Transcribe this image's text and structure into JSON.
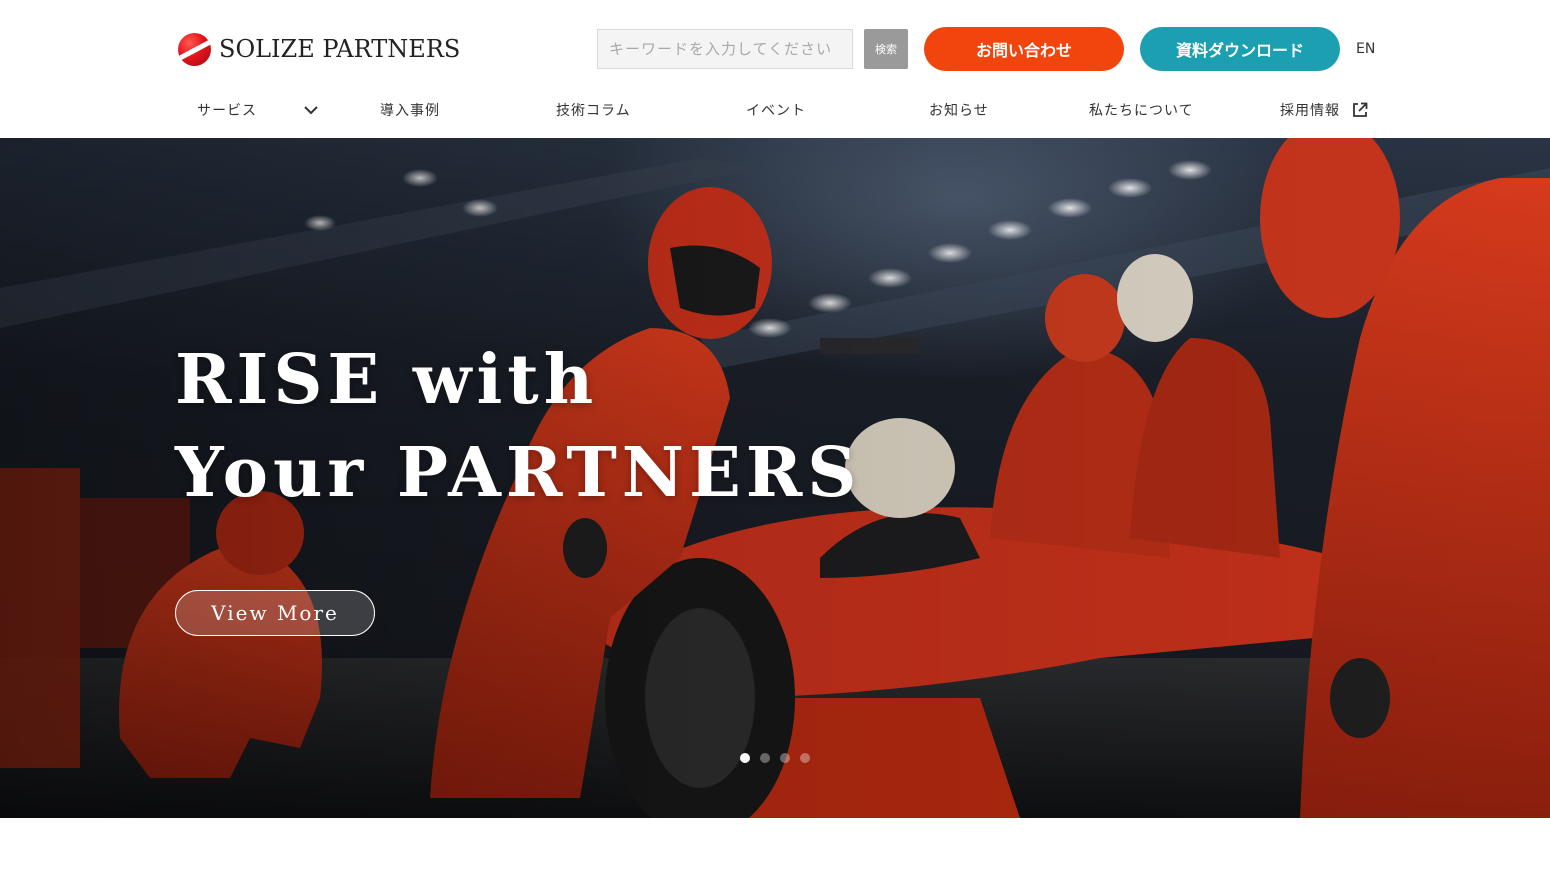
{
  "header": {
    "logo_text": "SOLIZE PARTNERS",
    "search": {
      "placeholder": "キーワードを入力してください",
      "button_label": "検索"
    },
    "contact_label": "お問い合わせ",
    "download_label": "資料ダウンロード",
    "lang_label": "EN"
  },
  "nav": {
    "items": [
      {
        "label": "サービス",
        "icon": "chevron-down-icon"
      },
      {
        "label": "導入事例"
      },
      {
        "label": "技術コラム"
      },
      {
        "label": "イベント"
      },
      {
        "label": "お知らせ"
      },
      {
        "label": "私たちについて"
      },
      {
        "label": "採用情報",
        "icon": "external-link-icon"
      }
    ]
  },
  "hero": {
    "title_line1": "RISE with",
    "title_line2": "Your PARTNERS",
    "cta_label": "View More",
    "slides_total": 4,
    "active_slide": 1
  },
  "colors": {
    "contact": "#f2450d",
    "download": "#1d9fb2",
    "search_button": "#9a9a9a",
    "logo_red": "#e3131b"
  }
}
